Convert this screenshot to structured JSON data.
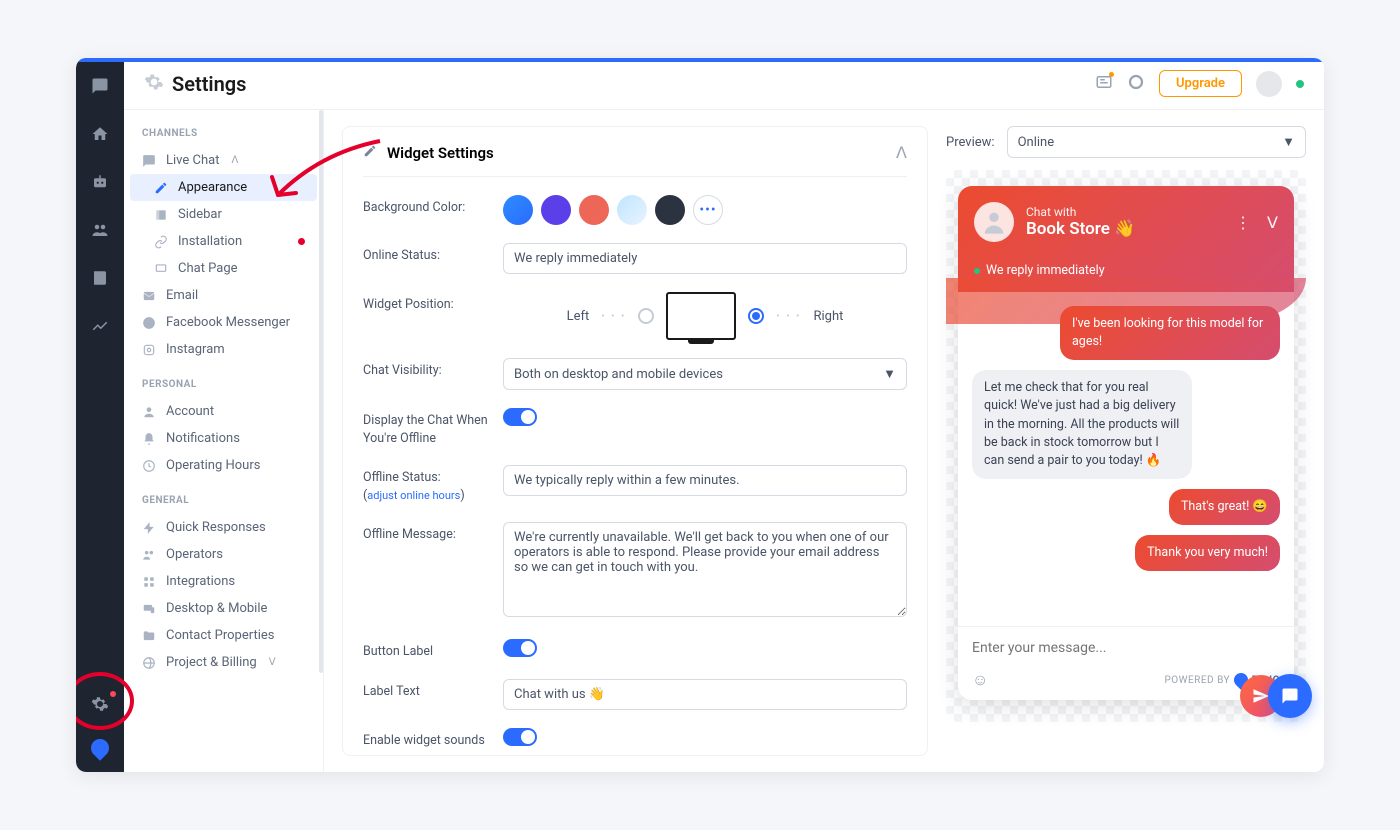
{
  "header": {
    "title": "Settings",
    "upgrade": "Upgrade"
  },
  "sidebar": {
    "groups": {
      "channels": "CHANNELS",
      "personal": "PERSONAL",
      "general": "GENERAL"
    },
    "live_chat": "Live Chat",
    "appearance": "Appearance",
    "sidebar_item": "Sidebar",
    "installation": "Installation",
    "chat_page": "Chat Page",
    "email": "Email",
    "fb": "Facebook Messenger",
    "instagram": "Instagram",
    "account": "Account",
    "notifications": "Notifications",
    "operating_hours": "Operating Hours",
    "quick_responses": "Quick Responses",
    "operators": "Operators",
    "integrations": "Integrations",
    "desktop_mobile": "Desktop & Mobile",
    "contact_properties": "Contact Properties",
    "project_billing": "Project & Billing"
  },
  "panel": {
    "title": "Widget Settings",
    "bg_color": "Background Color:",
    "online_status_label": "Online Status:",
    "online_status_value": "We reply immediately",
    "widget_position": "Widget Position:",
    "left": "Left",
    "right": "Right",
    "visibility_label": "Chat Visibility:",
    "visibility_value": "Both on desktop and mobile devices",
    "display_offline": "Display the Chat When You're Offline",
    "offline_status_label": "Offline Status:",
    "adjust_hours": "adjust online hours",
    "offline_status_value": "We typically reply within a few minutes.",
    "offline_message_label": "Offline Message:",
    "offline_message_value": "We're currently unavailable. We'll get back to you when one of our operators is able to respond. Please provide your email address so we can get in touch with you.",
    "button_label": "Button Label",
    "label_text": "Label Text",
    "label_text_value": "Chat with us 👋",
    "enable_sounds": "Enable widget sounds"
  },
  "preview": {
    "label": "Preview:",
    "status": "Online",
    "chat_with": "Chat with",
    "store_name": "Book Store 👋",
    "reply_status": "We reply immediately",
    "msg1": "I've been looking for this model for ages!",
    "msg2": "Let me check that for you real quick! We've just had a big delivery in the morning. All the products will be back in stock tomorrow but I can send a pair to you today! 🔥",
    "msg3": "That's great! 😄",
    "msg4": "Thank you very much!",
    "placeholder": "Enter your message...",
    "powered_by": "POWERED BY",
    "brand": "TIDIO"
  },
  "colors": {
    "swatches": [
      "linear-gradient(135deg,#2c8dff,#2c6bff)",
      "#5b3fe8",
      "#ee6658",
      "linear-gradient(135deg,#bfe5ff,#e9f3ff)",
      "#2b3340"
    ]
  }
}
